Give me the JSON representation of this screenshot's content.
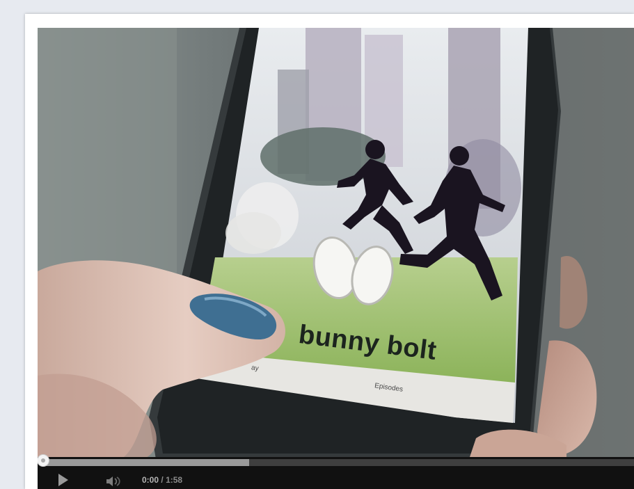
{
  "video": {
    "app_title": "bunny bolt",
    "app_nav": {
      "left_label": "ay",
      "right_label": "Episodes"
    },
    "controls": {
      "current_time": "0:00",
      "separator": "/",
      "duration": "1:58",
      "progress_buffered_fraction": 0.35
    }
  },
  "colors": {
    "page_background": "#e7eaf0",
    "card_background": "#ffffff",
    "controls_background": "#111111",
    "buffered_bar": "#9a9a9a"
  },
  "icons": {
    "play": "play-icon",
    "volume": "volume-icon",
    "progress_handle": "scrubber-handle-icon"
  }
}
